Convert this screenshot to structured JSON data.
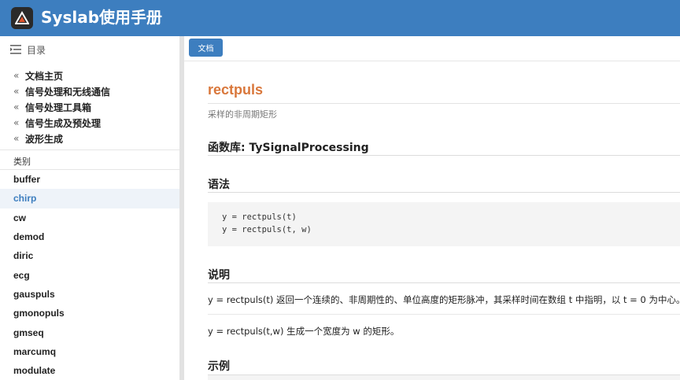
{
  "app": {
    "title": "Syslab使用手册"
  },
  "sidebar": {
    "toc_label": "目录",
    "breadcrumbs": [
      "文档主页",
      "信号处理和无线通信",
      "信号处理工具箱",
      "信号生成及预处理",
      "波形生成"
    ],
    "category_label": "类别",
    "functions": [
      "buffer",
      "chirp",
      "cw",
      "demod",
      "diric",
      "ecg",
      "gauspuls",
      "gmonopuls",
      "gmseq",
      "marcumq",
      "modulate"
    ],
    "active_function": "chirp"
  },
  "tabs": {
    "doc_button": "文档"
  },
  "page": {
    "title": "rectpuls",
    "subtitle": "采样的非周期矩形",
    "library": "函数库: TySignalProcessing",
    "syntax_heading": "语法",
    "syntax_lines": [
      "y = rectpuls(t)",
      "y = rectpuls(t, w)"
    ],
    "description_heading": "说明",
    "description_1": "y = rectpuls(t) 返回一个连续的、非周期性的、单位高度的矩形脉冲，其采样时间在数组 t 中指明，以 t = 0 为中心。",
    "description_2": "y = rectpuls(t,w) 生成一个宽度为 w 的矩形。",
    "examples_heading": "示例"
  },
  "colors": {
    "header_bg": "#3d7ebf",
    "title_accent": "#d9773b",
    "active_item": "#3d7ebf"
  }
}
